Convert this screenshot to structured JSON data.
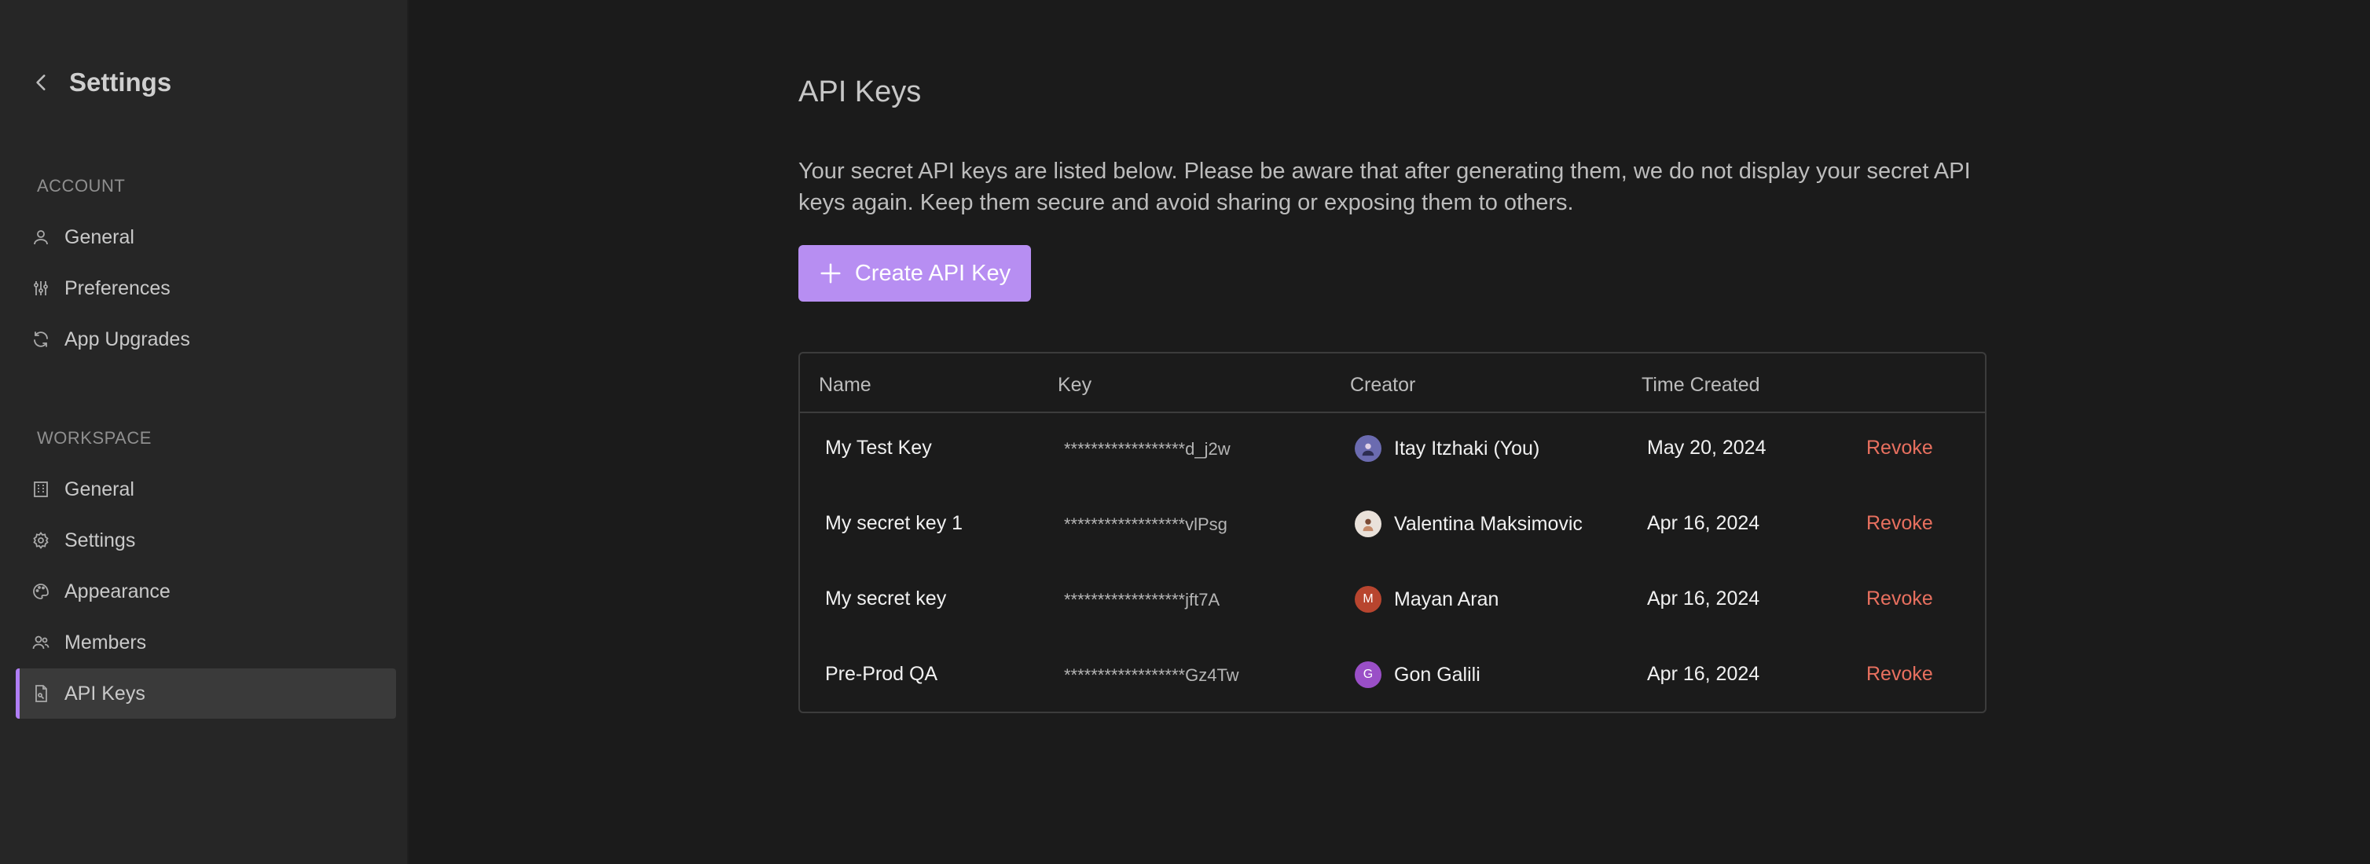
{
  "sidebar": {
    "title": "Settings",
    "account_label": "ACCOUNT",
    "account_items": [
      "General",
      "Preferences",
      "App Upgrades"
    ],
    "workspace_label": "WORKSPACE",
    "workspace_items": [
      "General",
      "Settings",
      "Appearance",
      "Members",
      "API Keys"
    ],
    "active_item": "API Keys"
  },
  "main": {
    "title": "API Keys",
    "description": "Your secret API keys are listed below. Please be aware that after generating them, we do not display your secret API keys again. Keep them secure and avoid sharing or exposing them to others.",
    "create_button": "Create API Key"
  },
  "table": {
    "headers": [
      "Name",
      "Key",
      "Creator",
      "Time Created"
    ],
    "rows": [
      {
        "name": "My Test Key",
        "key": "******************d_j2w",
        "creator": "Itay Itzhaki (You)",
        "avatar": "",
        "avatar_color": "#6b6bb0",
        "time": "May 20, 2024",
        "action": "Revoke"
      },
      {
        "name": "My secret key 1",
        "key": "******************vlPsg",
        "creator": "Valentina Maksimovic",
        "avatar": "",
        "avatar_color": "#e9e1da",
        "time": "Apr 16, 2024",
        "action": "Revoke"
      },
      {
        "name": "My secret key",
        "key": "******************jft7A",
        "creator": "Mayan Aran",
        "avatar": "M",
        "avatar_color": "#b8452f",
        "time": "Apr 16, 2024",
        "action": "Revoke"
      },
      {
        "name": "Pre-Prod QA",
        "key": "******************Gz4Tw",
        "creator": "Gon Galili",
        "avatar": "G",
        "avatar_color": "#9a4fc7",
        "time": "Apr 16, 2024",
        "action": "Revoke"
      }
    ]
  },
  "colors": {
    "accent": "#b78ef2",
    "danger": "#e8705f",
    "background": "#1b1b1b",
    "sidebar": "#262626"
  }
}
